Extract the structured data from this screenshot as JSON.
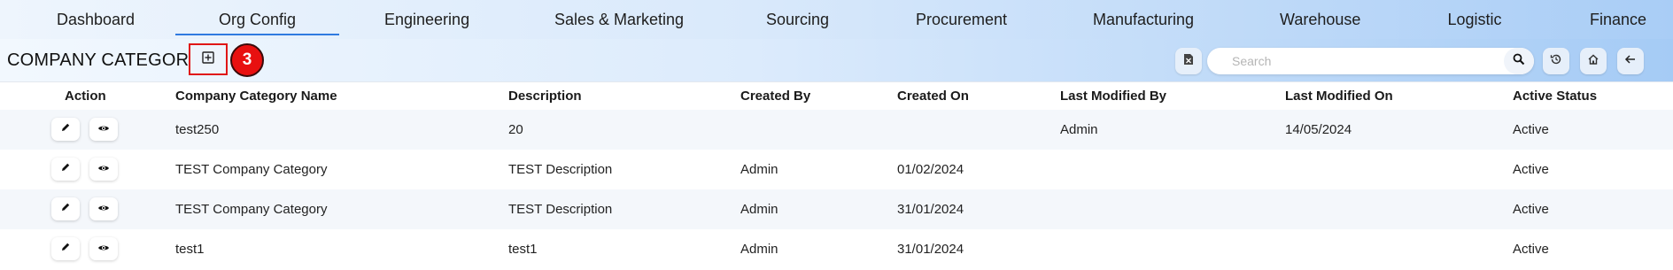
{
  "nav": {
    "tabs": [
      {
        "label": "Dashboard"
      },
      {
        "label": "Org Config"
      },
      {
        "label": "Engineering"
      },
      {
        "label": "Sales & Marketing"
      },
      {
        "label": "Sourcing"
      },
      {
        "label": "Procurement"
      },
      {
        "label": "Manufacturing"
      },
      {
        "label": "Warehouse"
      },
      {
        "label": "Logistic"
      },
      {
        "label": "Finance"
      }
    ],
    "active": "Org Config"
  },
  "toolbar": {
    "title": "COMPANY CATEGORY",
    "badge": "3",
    "search_placeholder": "Search",
    "search_value": "",
    "icons": [
      "add-box-icon",
      "excel-export-icon",
      "search-icon",
      "refresh-history-icon",
      "home-icon",
      "back-arrow-icon"
    ]
  },
  "table": {
    "columns": [
      "Action",
      "Company Category Name",
      "Description",
      "Created By",
      "Created On",
      "Last Modified By",
      "Last Modified On",
      "Active Status"
    ],
    "rows": [
      {
        "name": "test250",
        "description": "20",
        "created_by": "",
        "created_on": "",
        "modified_by": "Admin",
        "modified_on": "14/05/2024",
        "status": "Active"
      },
      {
        "name": "TEST Company Category",
        "description": "TEST Description",
        "created_by": "Admin",
        "created_on": "01/02/2024",
        "modified_by": "",
        "modified_on": "",
        "status": "Active"
      },
      {
        "name": "TEST Company Category",
        "description": "TEST Description",
        "created_by": "Admin",
        "created_on": "31/01/2024",
        "modified_by": "",
        "modified_on": "",
        "status": "Active"
      },
      {
        "name": "test1",
        "description": "test1",
        "created_by": "Admin",
        "created_on": "31/01/2024",
        "modified_by": "",
        "modified_on": "",
        "status": "Active"
      }
    ]
  },
  "colors": {
    "accent": "#2f7ae0",
    "badge": "#e81010",
    "highlight_border": "#e01616",
    "row_alt": "#f4f7fb"
  }
}
